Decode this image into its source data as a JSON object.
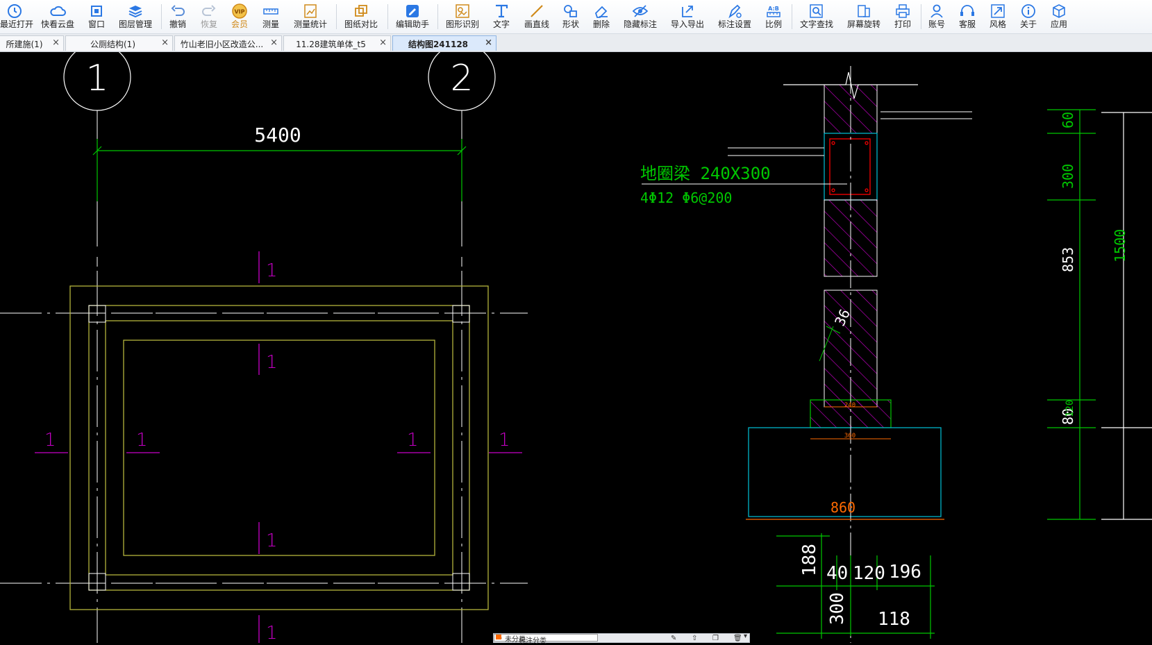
{
  "toolbar": {
    "items": [
      {
        "label": "最近打开",
        "icon": "clock-icon"
      },
      {
        "label": "快看云盘",
        "icon": "cloud-icon"
      },
      {
        "label": "窗口",
        "icon": "window-icon"
      },
      {
        "label": "图层管理",
        "icon": "layers-icon"
      },
      {
        "label": "撤销",
        "icon": "undo-icon"
      },
      {
        "label": "恢复",
        "icon": "redo-icon"
      },
      {
        "label": "会员",
        "icon": "vip-icon"
      },
      {
        "label": "测量",
        "icon": "ruler-icon"
      },
      {
        "label": "测量统计",
        "icon": "measure-stats-icon"
      },
      {
        "label": "图纸对比",
        "icon": "compare-icon"
      },
      {
        "label": "编辑助手",
        "icon": "edit-helper-icon"
      },
      {
        "label": "图形识别",
        "icon": "shape-recognize-icon"
      },
      {
        "label": "文字",
        "icon": "text-icon"
      },
      {
        "label": "画直线",
        "icon": "line-icon"
      },
      {
        "label": "形状",
        "icon": "shape-icon"
      },
      {
        "label": "删除",
        "icon": "eraser-icon"
      },
      {
        "label": "隐藏标注",
        "icon": "eye-hide-icon"
      },
      {
        "label": "导入导出",
        "icon": "import-export-icon"
      },
      {
        "label": "标注设置",
        "icon": "annotation-settings-icon"
      },
      {
        "label": "比例",
        "icon": "scale-icon"
      },
      {
        "label": "文字查找",
        "icon": "text-search-icon"
      },
      {
        "label": "屏幕旋转",
        "icon": "rotate-screen-icon"
      },
      {
        "label": "打印",
        "icon": "printer-icon"
      },
      {
        "label": "账号",
        "icon": "user-icon"
      },
      {
        "label": "客服",
        "icon": "headset-icon"
      },
      {
        "label": "风格",
        "icon": "style-icon"
      },
      {
        "label": "关于",
        "icon": "info-icon"
      },
      {
        "label": "应用",
        "icon": "cube-icon"
      }
    ],
    "vip_badge": "VIP",
    "scale_badge": "A:B"
  },
  "tabs": [
    {
      "label": "所建施(1)",
      "close": "×"
    },
    {
      "label": "公厕结构(1)",
      "close": "×"
    },
    {
      "label": "竹山老旧小区改造公...",
      "close": "×"
    },
    {
      "label": "11.28建筑单体_t5",
      "close": "×"
    },
    {
      "label": "结构图241128",
      "close": "×",
      "active": true
    }
  ],
  "drawing": {
    "grid_axis_1": "1",
    "grid_axis_2": "2",
    "span_dim": "5400",
    "section_mark": "1",
    "beam_label": "地圈梁 240X300",
    "beam_rebar": "4Φ12    Φ6@200",
    "dim_60": "60",
    "dim_300": "300",
    "dim_853": "853",
    "dim_1500": "1500",
    "dim_80": "80",
    "dim_120": "120",
    "dim_36": "36",
    "dim_240": "240",
    "dim_360": "360",
    "dim_860": "860",
    "dim_188": "188",
    "dim_40": "40",
    "dim_120b": "120",
    "dim_196": "196",
    "dim_300b": "300",
    "dim_118": "118"
  },
  "bottom_panel": {
    "label": "标注分类",
    "selected": "未分类"
  },
  "colors": {
    "green": "#00c800",
    "yellow": "#b4b43c",
    "white": "#ffffff",
    "magenta": "#c800c8",
    "cyan": "#00b4c8",
    "red": "#ff0000",
    "orange": "#ff6a00"
  }
}
